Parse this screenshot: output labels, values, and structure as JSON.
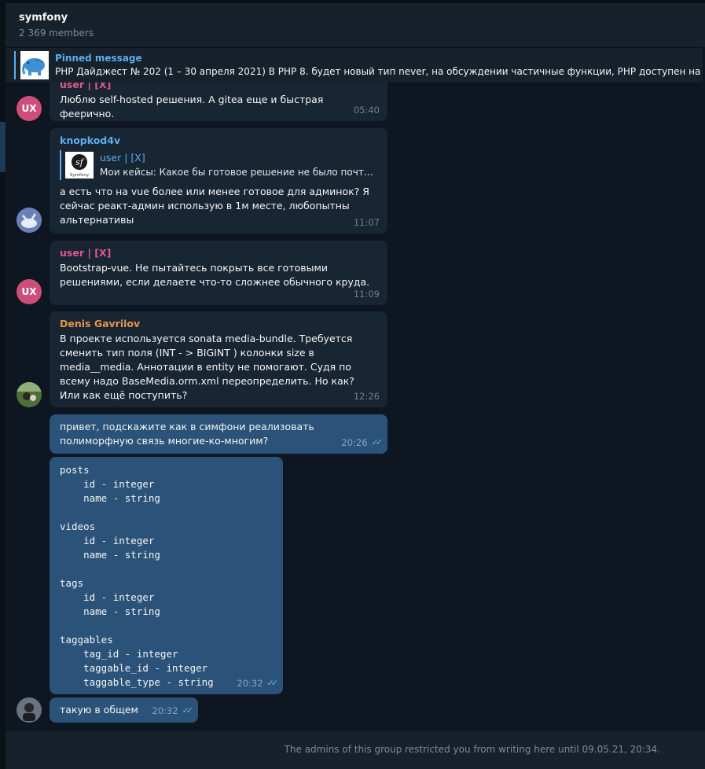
{
  "chat": {
    "title": "symfony",
    "members": "2 369 members"
  },
  "pinned": {
    "title": "Pinned message",
    "text": "PHP Дайджест № 202 (1 – 30 апреля 2021)  В PHP 8. будет новый тип never, на обсуждении частичные функции, PHP доступен на Go"
  },
  "messages": [
    {
      "sender": "user | [X]",
      "sender_color": "#e4578f",
      "text": "Люблю self-hosted решения. А gitea еще и быстрая феерично.",
      "time": "05:40",
      "avatar": "UX"
    },
    {
      "sender": "knopkod4v",
      "sender_color": "#5eadf0",
      "reply_author": "user | [X]",
      "reply_text": "Мои кейсы: Какое бы готовое решение не было почт…",
      "reply_logo": "Symfony",
      "text": "а есть что на vue более или менее готовое для админок? Я сейчас реакт-админ использую в 1м месте, любопытны альтернативы",
      "time": "11:07"
    },
    {
      "sender": "user | [X]",
      "sender_color": "#e4578f",
      "text": "Bootstrap-vue. Не пытайтесь покрыть все готовыми решениями, если делаете что-то сложнее обычного круда.",
      "time": "11:09",
      "avatar": "UX"
    },
    {
      "sender": "Denis Gavrilov",
      "sender_color": "#e8944a",
      "text": "В проекте используется sonata media-bundle. Требуется сменить тип поля (INT - > BIGINT ) колонки size в  media__media. Аннотации в entity не помогают. Судя по всему надо BaseMedia.orm.xml переопределить. Но как? Или как ещё поступить?",
      "time": "12:26"
    },
    {
      "text": "привет, подскажите как в симфони реализовать полиморфную связь многие-ко-многим?",
      "time": "20:26"
    },
    {
      "code": "posts\n    id - integer\n    name - string\n\nvideos\n    id - integer\n    name - string\n\ntags\n    id - integer\n    name - string\n\ntaggables\n    tag_id - integer\n    taggable_id - integer\n    taggable_type - string",
      "time": "20:32"
    },
    {
      "text": "такую в общем",
      "time": "20:32"
    }
  ],
  "footer": {
    "notice": "The admins of this group restricted you from writing here until 09.05.21, 20:34."
  },
  "colors": {
    "background": "#0e1621",
    "panel": "#17212b",
    "incoming_bubble": "#182533",
    "outgoing_bubble": "#2b5278",
    "accent": "#5eadf0"
  }
}
